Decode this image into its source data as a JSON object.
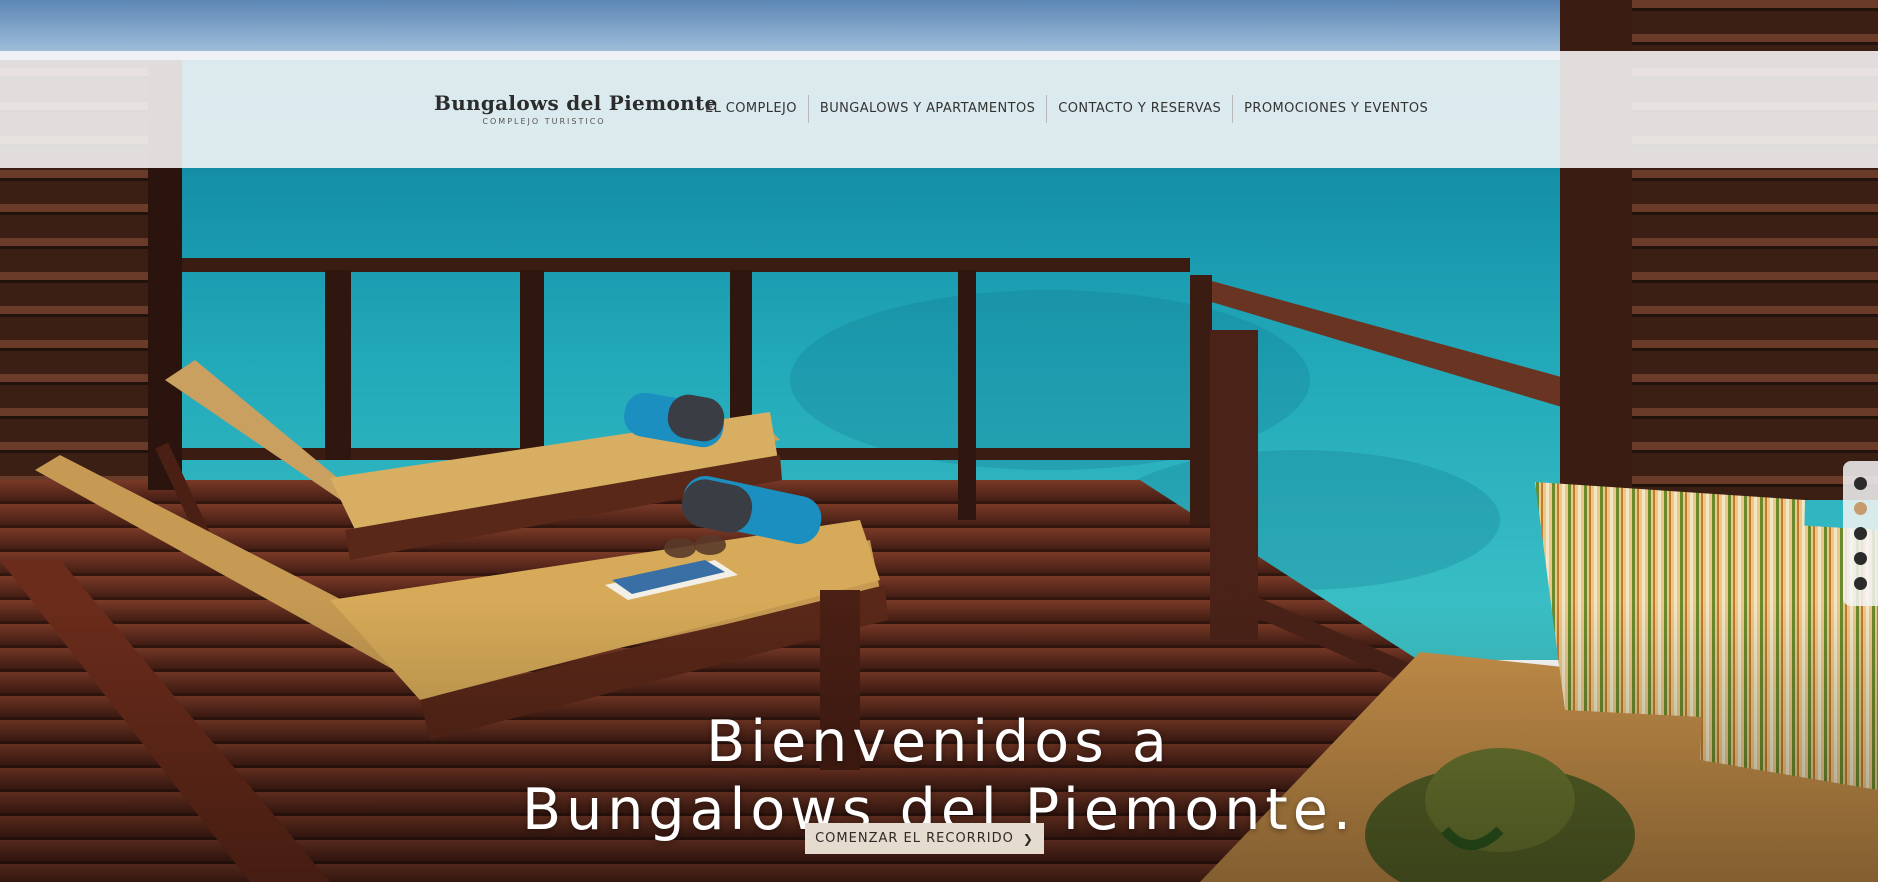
{
  "brand": {
    "name": "Bungalows del Piemonte",
    "tagline": "COMPLEJO TURISTICO"
  },
  "nav": {
    "items": [
      {
        "label": "EL COMPLEJO"
      },
      {
        "label": "BUNGALOWS Y APARTAMENTOS"
      },
      {
        "label": "CONTACTO Y RESERVAS"
      },
      {
        "label": "PROMOCIONES Y EVENTOS"
      }
    ]
  },
  "hero": {
    "headline_line1": "Bienvenidos a",
    "headline_line2": "Bungalows del Piemonte.",
    "cta_label": "COMENZAR EL RECORRIDO",
    "cta_icon": "chevron-right-icon"
  },
  "slider": {
    "dot_count": 5,
    "active_index": 1
  },
  "colors": {
    "sea": "#1fa3b5",
    "deck": "#6a2e1f",
    "cushion": "#c69a52",
    "accent": "#c69b6d",
    "button_bg": "#e6dbcf"
  }
}
